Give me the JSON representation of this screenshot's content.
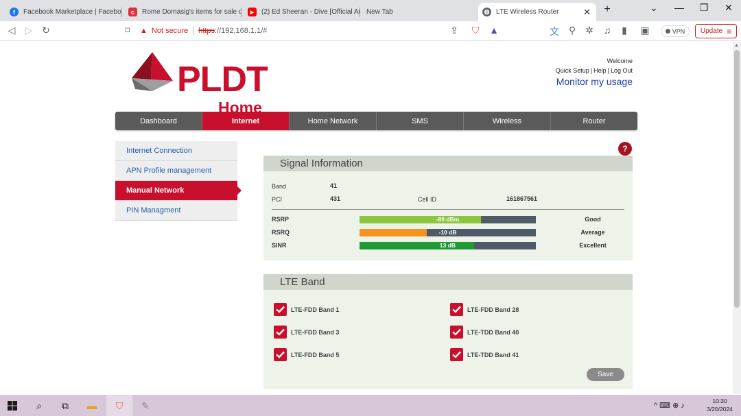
{
  "browser": {
    "tabs": [
      {
        "title": "Facebook Marketplace | Faceboo",
        "icon": "facebook-icon",
        "color": "#1877f2"
      },
      {
        "title": "Rome Domasig's items for sale o",
        "icon": "carousell-icon",
        "color": "#e0303f"
      },
      {
        "title": "(2) Ed Sheeran - Dive [Official Au",
        "icon": "youtube-icon",
        "color": "#ff0000"
      },
      {
        "title": "New Tab",
        "icon": "",
        "color": ""
      },
      {
        "title": "LTE Wireless Router",
        "icon": "globe-icon",
        "color": "#5f6368"
      }
    ],
    "new_tab": "+",
    "window_controls": [
      "⌄",
      "—",
      "❐",
      "✕"
    ],
    "security_label": "Not secure",
    "url_scheme": "https",
    "url_rest": "://192.168.1.1/#",
    "vpn_label": "VPN",
    "update_label": "Update"
  },
  "header": {
    "logo_main": "PLDT",
    "logo_sub": "Home",
    "welcome": "Welcome",
    "links": [
      "Quick Setup",
      "Help",
      "Log Out"
    ],
    "monitor": "Monitor my usage"
  },
  "nav": {
    "items": [
      "Dashboard",
      "Internet",
      "Home Network",
      "SMS",
      "Wireless",
      "Router"
    ],
    "active": "Internet"
  },
  "sidebar": {
    "items": [
      "Internet Connection",
      "APN Profile management",
      "Manual Network",
      "PIN Managment"
    ],
    "active": "Manual Network"
  },
  "help_label": "?",
  "signal": {
    "title": "Signal Information",
    "band_label": "Band",
    "band_value": "41",
    "pci_label": "PCI",
    "pci_value": "431",
    "cellid_label": "Cell ID",
    "cellid_value": "161867561",
    "metrics": [
      {
        "label": "RSRP",
        "value": "-89 dBm",
        "fill": 0.69,
        "color": "#8cc63f",
        "quality": "Good"
      },
      {
        "label": "RSRQ",
        "value": "-10 dB",
        "fill": 0.38,
        "color": "#f7941d",
        "quality": "Average"
      },
      {
        "label": "SINR",
        "value": "13 dB",
        "fill": 0.65,
        "color": "#1e9b34",
        "quality": "Excellent"
      }
    ]
  },
  "lte": {
    "title": "LTE Band",
    "bands": [
      {
        "label": "LTE-FDD Band 1",
        "checked": true
      },
      {
        "label": "LTE-FDD Band 28",
        "checked": true
      },
      {
        "label": "LTE-FDD Band 3",
        "checked": true
      },
      {
        "label": "LTE-TDD Band 40",
        "checked": true
      },
      {
        "label": "LTE-FDD Band 5",
        "checked": true
      },
      {
        "label": "LTE-TDD Band 41",
        "checked": true
      }
    ],
    "save_label": "Save"
  },
  "taskbar": {
    "time": "10:30",
    "date": "3/20/2024"
  }
}
